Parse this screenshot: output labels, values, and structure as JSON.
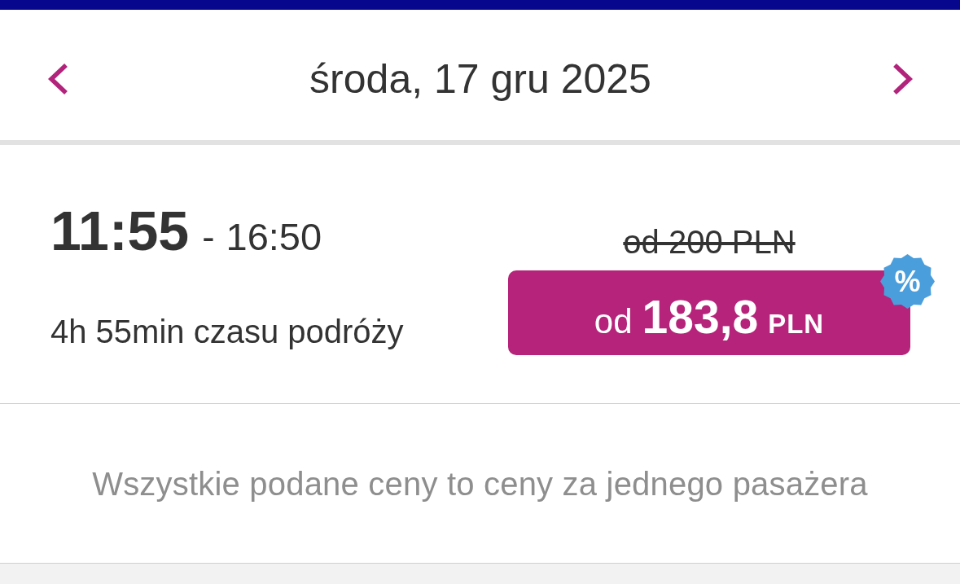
{
  "header": {
    "date": "środa, 17 gru 2025"
  },
  "flight": {
    "departure": "11:55",
    "separator": "-",
    "arrival": "16:50",
    "duration": "4h 55min czasu podróży",
    "old_price": "od 200 PLN",
    "price": {
      "prefix": "od",
      "amount": "183,8",
      "currency": "PLN"
    },
    "discount_badge": "%"
  },
  "note": "Wszystkie podane ceny to ceny za jednego pasażera"
}
